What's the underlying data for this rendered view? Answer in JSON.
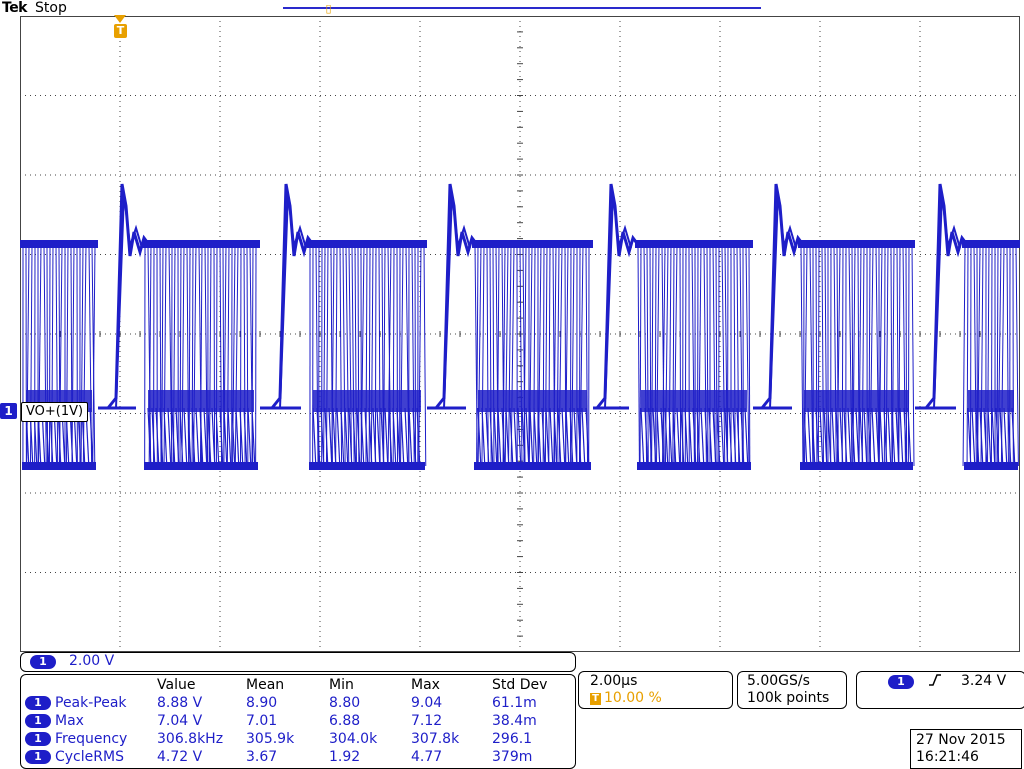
{
  "header": {
    "brand": "Tek",
    "acq_state": "Stop"
  },
  "colors": {
    "channel": "#1e1ec8",
    "trigger": "#e8a000",
    "graticule": "#444444"
  },
  "icons": {
    "trigger_marker": "T-marker-icon",
    "trigger_slope": "rising-edge-icon"
  },
  "trigger_marker_label": "T",
  "channel": {
    "number": "1",
    "label": "VO+(1V)",
    "scale": "2.00 V"
  },
  "measurements": {
    "headers": [
      "Value",
      "Mean",
      "Min",
      "Max",
      "Std Dev"
    ],
    "rows": [
      {
        "ch": "1",
        "name": "Peak-Peak",
        "value": "8.88 V",
        "mean": "8.90",
        "min": "8.80",
        "max": "9.04",
        "std": "61.1m"
      },
      {
        "ch": "1",
        "name": "Max",
        "value": "7.04 V",
        "mean": "7.01",
        "min": "6.88",
        "max": "7.12",
        "std": "38.4m"
      },
      {
        "ch": "1",
        "name": "Frequency",
        "value": "306.8kHz",
        "mean": "305.9k",
        "min": "304.0k",
        "max": "307.8k",
        "std": "296.1"
      },
      {
        "ch": "1",
        "name": "CycleRMS",
        "value": "4.72 V",
        "mean": "3.67",
        "min": "1.92",
        "max": "4.77",
        "std": "379m"
      }
    ]
  },
  "horizontal": {
    "timebase": "2.00µs",
    "trigger_position": "10.00 %"
  },
  "acquisition": {
    "sample_rate": "5.00GS/s",
    "record_length": "100k points"
  },
  "trigger": {
    "source": "1",
    "slope_symbol": "ʃ",
    "level": "3.24 V"
  },
  "datetime": {
    "date": "27 Nov 2015",
    "time": "16:21:46"
  }
}
